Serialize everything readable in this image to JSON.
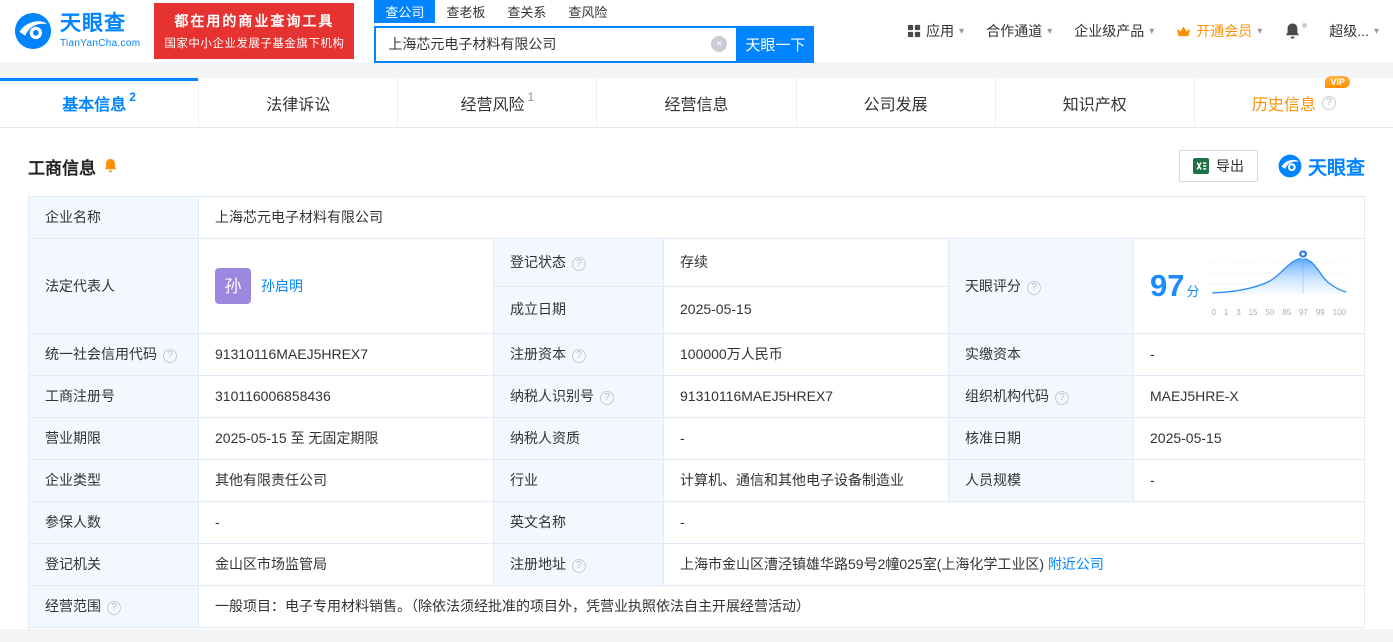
{
  "colors": {
    "primary_blue": "#0084ff",
    "promo_red": "#e63230",
    "status_green": "#00b26a",
    "vip_orange": "#ff9000",
    "label_cell_bg": "#f2f8fe"
  },
  "icons": {
    "caret_down": "▾",
    "clear": "×",
    "help": "?"
  },
  "header": {
    "logo": {
      "name": "天眼查",
      "domain": "TianYanCha.com"
    },
    "promo": {
      "line1": "都在用的商业查询工具",
      "line2": "国家中小企业发展子基金旗下机构"
    },
    "search": {
      "tabs": [
        {
          "label": "查公司"
        },
        {
          "label": "查老板"
        },
        {
          "label": "查关系"
        },
        {
          "label": "查风险"
        }
      ],
      "value": "上海芯元电子材料有限公司",
      "button": "天眼一下"
    },
    "nav": {
      "apps": "应用",
      "cooperation": "合作通道",
      "enterprise": "企业级产品",
      "vip": "开通会员",
      "super": "超级..."
    }
  },
  "tabs": [
    {
      "label": "基本信息",
      "badge": "2"
    },
    {
      "label": "法律诉讼",
      "badge": ""
    },
    {
      "label": "经营风险",
      "badge": "1"
    },
    {
      "label": "经营信息",
      "badge": ""
    },
    {
      "label": "公司发展",
      "badge": ""
    },
    {
      "label": "知识产权",
      "badge": ""
    },
    {
      "label": "历史信息",
      "badge": "",
      "vip_tag": "VIP"
    }
  ],
  "section": {
    "title": "工商信息",
    "export": "导出",
    "brand": "天眼查"
  },
  "table": {
    "company_name": {
      "label": "企业名称",
      "value": "上海芯元电子材料有限公司"
    },
    "legal_rep": {
      "label": "法定代表人",
      "avatar": "孙",
      "value": "孙启明"
    },
    "reg_status": {
      "label": "登记状态",
      "value": "存续"
    },
    "establish_date": {
      "label": "成立日期",
      "value": "2025-05-15"
    },
    "score": {
      "label": "天眼评分",
      "value": "97",
      "unit": "分",
      "axis": [
        "0",
        "1",
        "3",
        "15",
        "50",
        "85",
        "97",
        "99",
        "100"
      ]
    },
    "credit_code": {
      "label": "统一社会信用代码",
      "value": "91310116MAEJ5HREX7"
    },
    "reg_capital": {
      "label": "注册资本",
      "value": "100000万人民币"
    },
    "paid_capital": {
      "label": "实缴资本",
      "value": "-"
    },
    "reg_number": {
      "label": "工商注册号",
      "value": "310116006858436"
    },
    "taxpayer_id": {
      "label": "纳税人识别号",
      "value": "91310116MAEJ5HREX7"
    },
    "org_code": {
      "label": "组织机构代码",
      "value": "MAEJ5HRE-X"
    },
    "business_term": {
      "label": "营业期限",
      "value": "2025-05-15 至 无固定期限"
    },
    "taxpayer_quality": {
      "label": "纳税人资质",
      "value": "-"
    },
    "approval_date": {
      "label": "核准日期",
      "value": "2025-05-15"
    },
    "company_type": {
      "label": "企业类型",
      "value": "其他有限责任公司"
    },
    "industry": {
      "label": "行业",
      "value": "计算机、通信和其他电子设备制造业"
    },
    "staff_size": {
      "label": "人员规模",
      "value": "-"
    },
    "insured_count": {
      "label": "参保人数",
      "value": "-"
    },
    "english_name": {
      "label": "英文名称",
      "value": "-"
    },
    "reg_authority": {
      "label": "登记机关",
      "value": "金山区市场监管局"
    },
    "reg_address": {
      "label": "注册地址",
      "value": "上海市金山区漕泾镇雄华路59号2幢025室(上海化学工业区)",
      "link": "附近公司"
    },
    "business_scope": {
      "label": "经营范围",
      "value": "一般项目：电子专用材料销售。（除依法须经批准的项目外，凭营业执照依法自主开展经营活动）"
    }
  }
}
